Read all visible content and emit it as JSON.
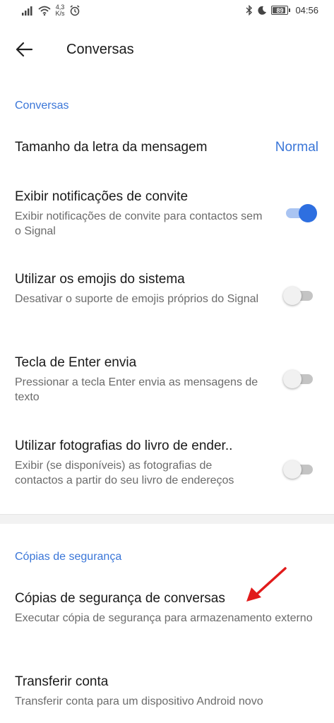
{
  "status_bar": {
    "speed_value": "4,3",
    "speed_unit": "K/s",
    "battery": "89",
    "time": "04:56"
  },
  "app_bar": {
    "title": "Conversas"
  },
  "sections": {
    "conversas": {
      "header": "Conversas",
      "message_size": {
        "title": "Tamanho da letra da mensagem",
        "value": "Normal"
      },
      "invite_notifications": {
        "title": "Exibir notificações de convite",
        "subtitle": "Exibir notificações de convite para contactos sem o Signal",
        "enabled": true
      },
      "system_emoji": {
        "title": "Utilizar os emojis do sistema",
        "subtitle": "Desativar o suporte de emojis próprios do Signal",
        "enabled": false
      },
      "enter_sends": {
        "title": "Tecla de Enter envia",
        "subtitle": "Pressionar a tecla Enter envia as mensagens de texto",
        "enabled": false
      },
      "address_book_photos": {
        "title": "Utilizar fotografias do livro de ender..",
        "subtitle": "Exibir (se disponíveis) as fotografias de contactos a partir do seu livro de endereços",
        "enabled": false
      }
    },
    "backups": {
      "header": "Cópias de segurança",
      "chat_backups": {
        "title": "Cópias de segurança de conversas",
        "subtitle": "Executar cópia de segurança para armazenamento externo"
      },
      "transfer_account": {
        "title": "Transferir conta",
        "subtitle": "Transferir conta para um dispositivo Android novo"
      }
    }
  },
  "colors": {
    "accent": "#3a76d8",
    "switch_on": "#2e6fe0",
    "annotation_arrow": "#e11b1b"
  }
}
